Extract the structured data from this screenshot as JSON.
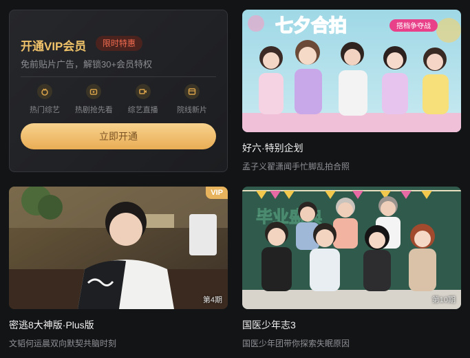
{
  "vip": {
    "title": "开通VIP会员",
    "badge": "限时特惠",
    "subtitle": "免前贴片广告，解锁30+会员特权",
    "perks": [
      {
        "label": "热门综艺",
        "icon": "variety-icon"
      },
      {
        "label": "热剧抢先看",
        "icon": "drama-icon"
      },
      {
        "label": "综艺直播",
        "icon": "live-icon"
      },
      {
        "label": "院线新片",
        "icon": "cinema-icon"
      }
    ],
    "cta_label": "立即开通"
  },
  "cards": [
    {
      "title": "好六·特别企划",
      "subtitle": "孟子义翟潇闻手忙脚乱拍合照",
      "poster_text": "七夕合拍",
      "poster_subtext": "搭档争夺战",
      "vip_tag": "",
      "episode": ""
    },
    {
      "title": "密逃8大神版·Plus版",
      "subtitle": "文韬何运晨双向默契共脑时刻",
      "poster_text": "",
      "poster_subtext": "",
      "vip_tag": "VIP",
      "episode": "第4期"
    },
    {
      "title": "国医少年志3",
      "subtitle": "国医少年团带你探索失眠原因",
      "poster_text": "毕业盛典",
      "poster_subtext": "",
      "vip_tag": "",
      "episode": "第10期"
    }
  ],
  "colors": {
    "accent": "#f0c36a",
    "badge_text": "#f26b4f",
    "cta_start": "#f7d38e",
    "cta_end": "#e9ad55"
  }
}
